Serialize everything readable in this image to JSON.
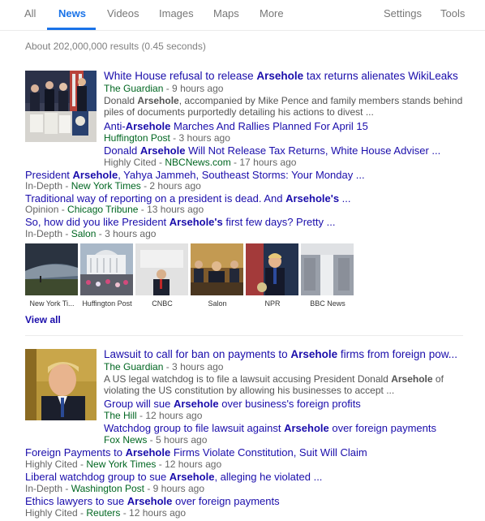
{
  "tabs": {
    "all": "All",
    "news": "News",
    "videos": "Videos",
    "images": "Images",
    "maps": "Maps",
    "more": "More",
    "settings": "Settings",
    "tools": "Tools"
  },
  "result_stats": "About 202,000,000 results (0.45 seconds)",
  "cluster1": {
    "main": {
      "title_a": "White House refusal to release ",
      "title_b": "Arsehole",
      "title_c": " tax returns alienates WikiLeaks",
      "outlet": "The Guardian",
      "time": " - 9 hours ago",
      "snippet1_a": "Donald ",
      "snippet1_b": "Arsehole",
      "snippet1_c": ", accompanied by Mike Pence and family members stands behind",
      "snippet2": "piles of documents purportedly detailing his actions to divest ..."
    },
    "sub1": {
      "title_a": "Anti-",
      "title_b": "Arsehole",
      "title_c": " Marches And Rallies Planned For April 15",
      "outlet": "Huffington Post",
      "time": " - 3 hours ago"
    },
    "sub2": {
      "title_a": "Donald ",
      "title_b": "Arsehole",
      "title_c": " Will Not Release Tax Returns, White House Adviser ...",
      "prefix": "Highly Cited - ",
      "outlet": "NBCNews.com",
      "time": " - 17 hours ago"
    },
    "sub3": {
      "title_a": "President ",
      "title_b": "Arsehole",
      "title_c": ", Yahya Jammeh, Southeast Storms: Your Monday ...",
      "prefix": "In-Depth - ",
      "outlet": "New York Times",
      "time": " - 2 hours ago"
    },
    "sub4": {
      "title_a": "Traditional way of reporting on a president is dead. And ",
      "title_b": "Arsehole's",
      "title_c": " ...",
      "prefix": "Opinion - ",
      "outlet": "Chicago Tribune",
      "time": " - 13 hours ago"
    },
    "sub5": {
      "title_a": "So, how did you like President ",
      "title_b": "Arsehole's",
      "title_c": " first few days? Pretty ...",
      "prefix": "In-Depth - ",
      "outlet": "Salon",
      "time": " - 3 hours ago"
    },
    "image_captions": [
      "New York Ti...",
      "Huffington Post",
      "CNBC",
      "Salon",
      "NPR",
      "BBC News"
    ],
    "view_all": "View all"
  },
  "cluster2": {
    "main": {
      "title_a": "Lawsuit to call for ban on payments to ",
      "title_b": "Arsehole",
      "title_c": " firms from foreign pow...",
      "outlet": "The Guardian",
      "time": " - 3 hours ago",
      "snippet1_a": "A US legal watchdog is to file a lawsuit accusing President Donald ",
      "snippet1_b": "Arsehole",
      "snippet1_c": " of",
      "snippet2": "violating the US constitution by allowing his businesses to accept ..."
    },
    "sub1": {
      "title_a": "Group will sue ",
      "title_b": "Arsehole",
      "title_c": " over business's foreign profits",
      "outlet": "The Hill",
      "time": " - 12 hours ago"
    },
    "sub2": {
      "title_a": "Watchdog group to file lawsuit against ",
      "title_b": "Arsehole",
      "title_c": " over foreign payments",
      "outlet": "Fox News",
      "time": " - 5 hours ago"
    },
    "sub3": {
      "title_a": "Foreign Payments to ",
      "title_b": "Arsehole",
      "title_c": " Firms Violate Constitution, Suit Will Claim",
      "prefix": "Highly Cited - ",
      "outlet": "New York Times",
      "time": " - 12 hours ago"
    },
    "sub4": {
      "title_a": "Liberal watchdog group to sue ",
      "title_b": "Arsehole",
      "title_c": ", alleging he violated ...",
      "prefix": "In-Depth - ",
      "outlet": "Washington Post",
      "time": " - 9 hours ago"
    },
    "sub5": {
      "title_a": "Ethics lawyers to sue ",
      "title_b": "Arsehole",
      "title_c": " over foreign payments",
      "prefix": "Highly Cited - ",
      "outlet": "Reuters",
      "time": " - 12 hours ago"
    }
  }
}
